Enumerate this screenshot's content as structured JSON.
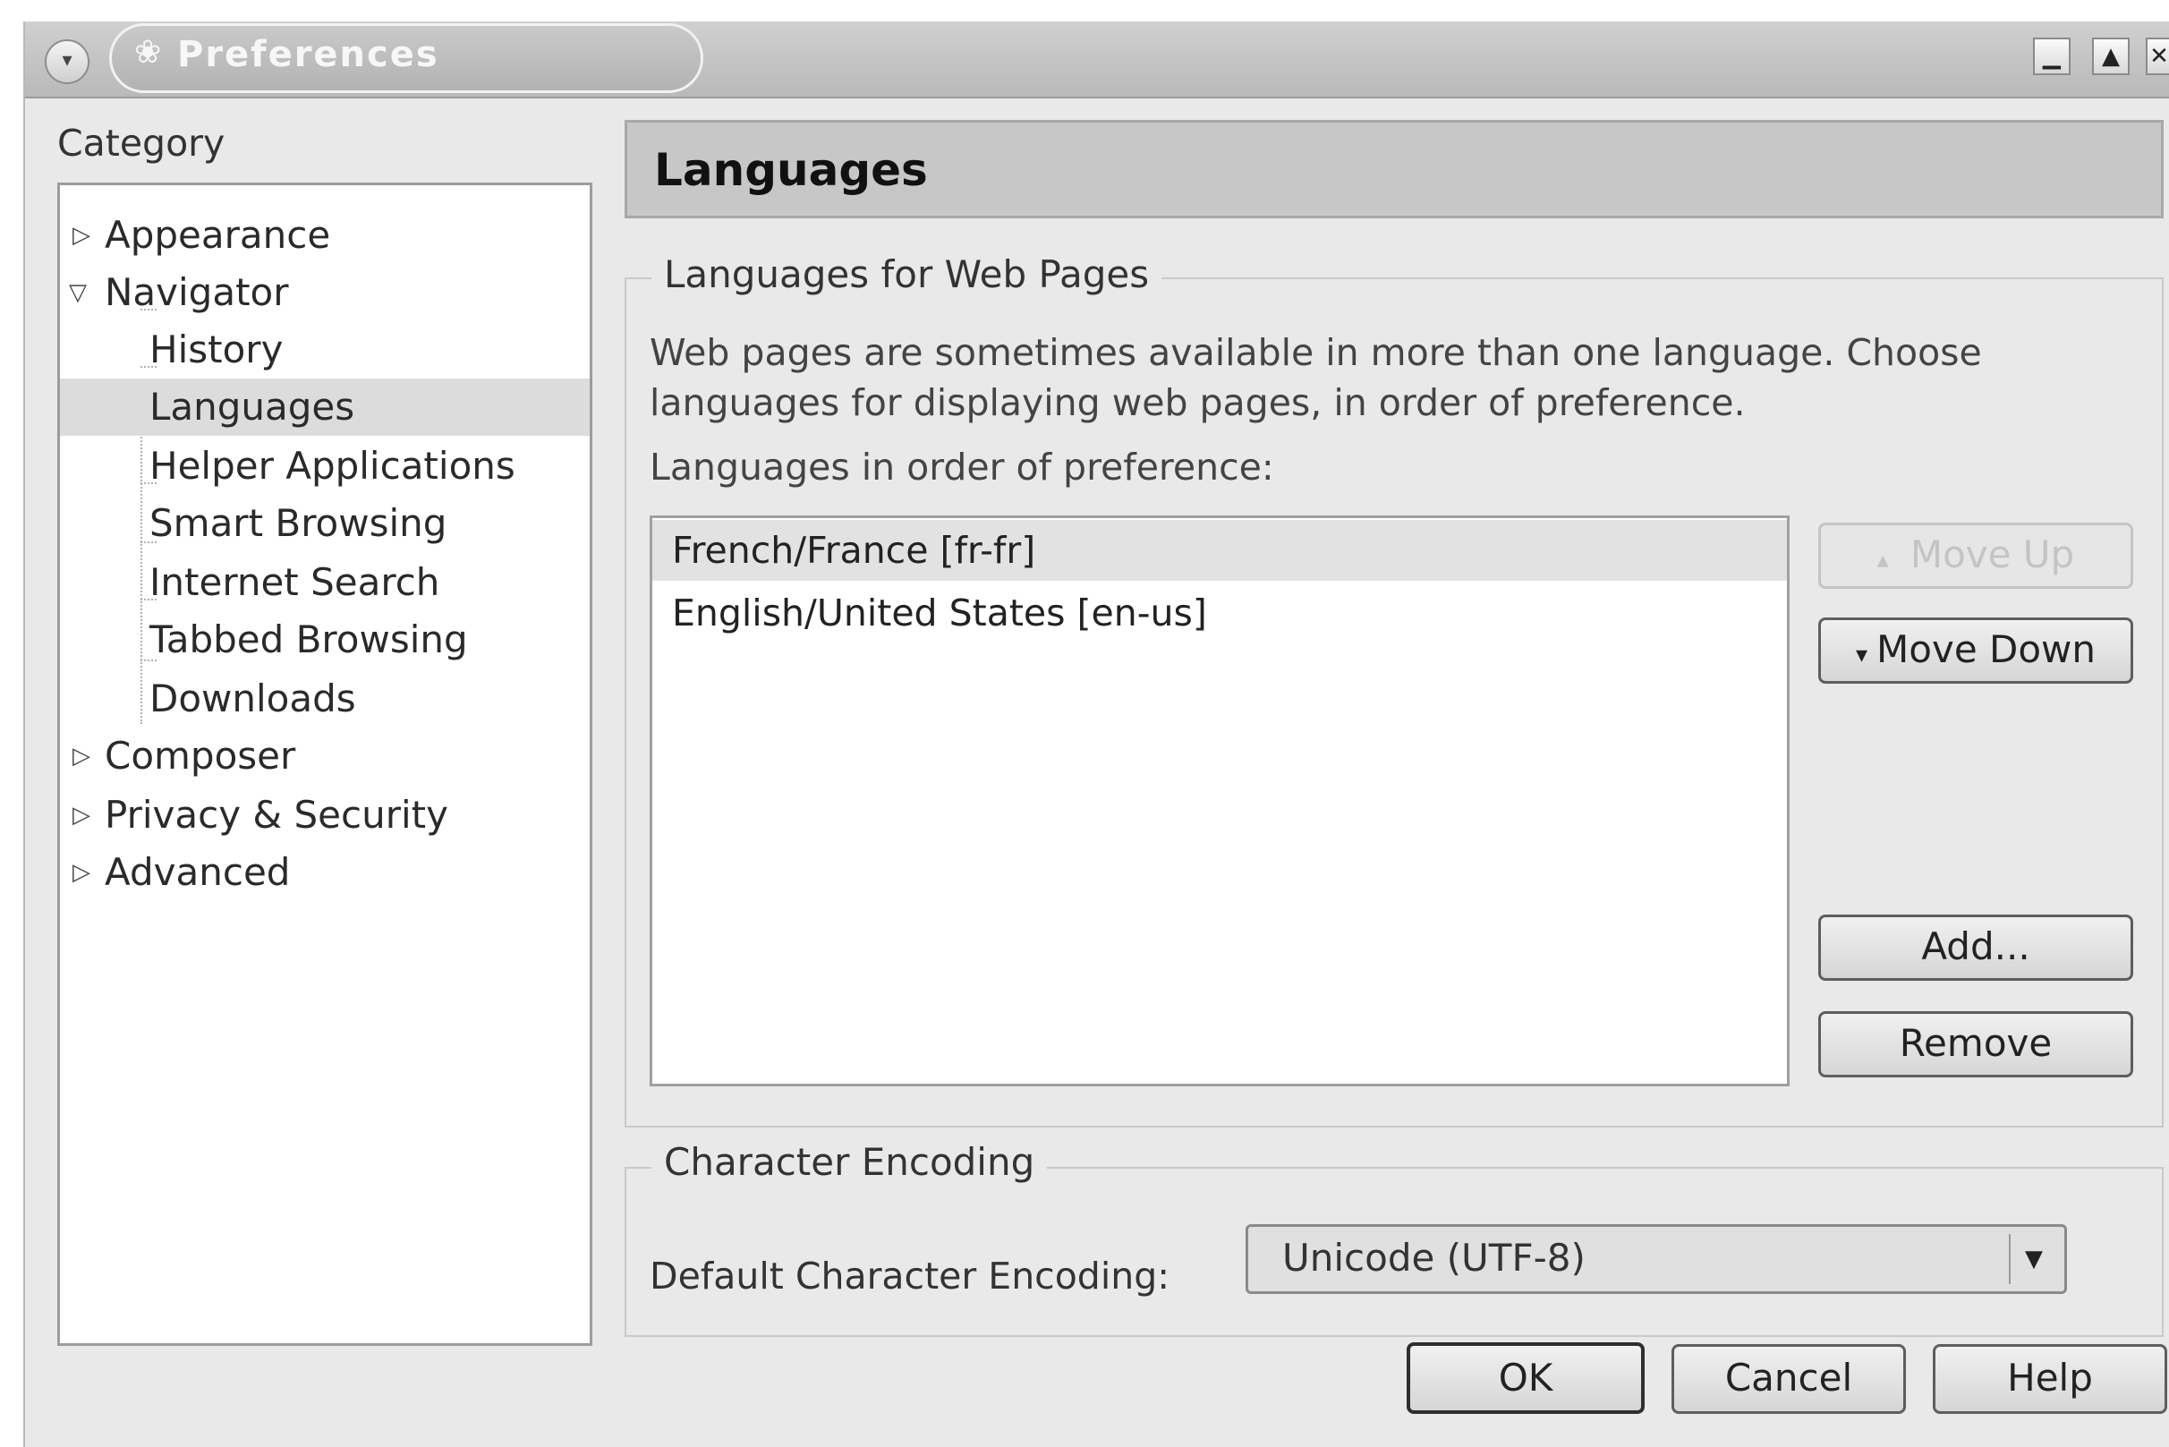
{
  "window": {
    "title": "Preferences",
    "controls": [
      "minimize",
      "maximize",
      "close"
    ]
  },
  "sidebar": {
    "label": "Category",
    "items": [
      {
        "label": "Appearance",
        "level": 0,
        "state": "collapsed"
      },
      {
        "label": "Navigator",
        "level": 0,
        "state": "expanded"
      },
      {
        "label": "History",
        "level": 1
      },
      {
        "label": "Languages",
        "level": 1,
        "selected": true
      },
      {
        "label": "Helper Applications",
        "level": 1
      },
      {
        "label": "Smart Browsing",
        "level": 1
      },
      {
        "label": "Internet Search",
        "level": 1
      },
      {
        "label": "Tabbed Browsing",
        "level": 1
      },
      {
        "label": "Downloads",
        "level": 1
      },
      {
        "label": "Composer",
        "level": 0,
        "state": "collapsed"
      },
      {
        "label": "Privacy & Security",
        "level": 0,
        "state": "collapsed"
      },
      {
        "label": "Advanced",
        "level": 0,
        "state": "collapsed"
      }
    ]
  },
  "main": {
    "title": "Languages",
    "languages_group": {
      "legend": "Languages for Web Pages",
      "description_line1": "Web pages are sometimes available in more than one language. Choose",
      "description_line2": "languages for displaying web pages, in order of preference.",
      "list_label": "Languages in order of preference:",
      "languages": [
        {
          "label": "French/France  [fr-fr]",
          "selected": true
        },
        {
          "label": "English/United States  [en-us]",
          "selected": false
        }
      ],
      "move_up_label": "Move Up",
      "move_down_label": "Move Down",
      "add_label": "Add...",
      "remove_label": "Remove"
    },
    "encoding_group": {
      "legend": "Character Encoding",
      "label": "Default Character Encoding:",
      "value": "Unicode (UTF-8)"
    }
  },
  "footer": {
    "ok_label": "OK",
    "cancel_label": "Cancel",
    "help_label": "Help"
  }
}
